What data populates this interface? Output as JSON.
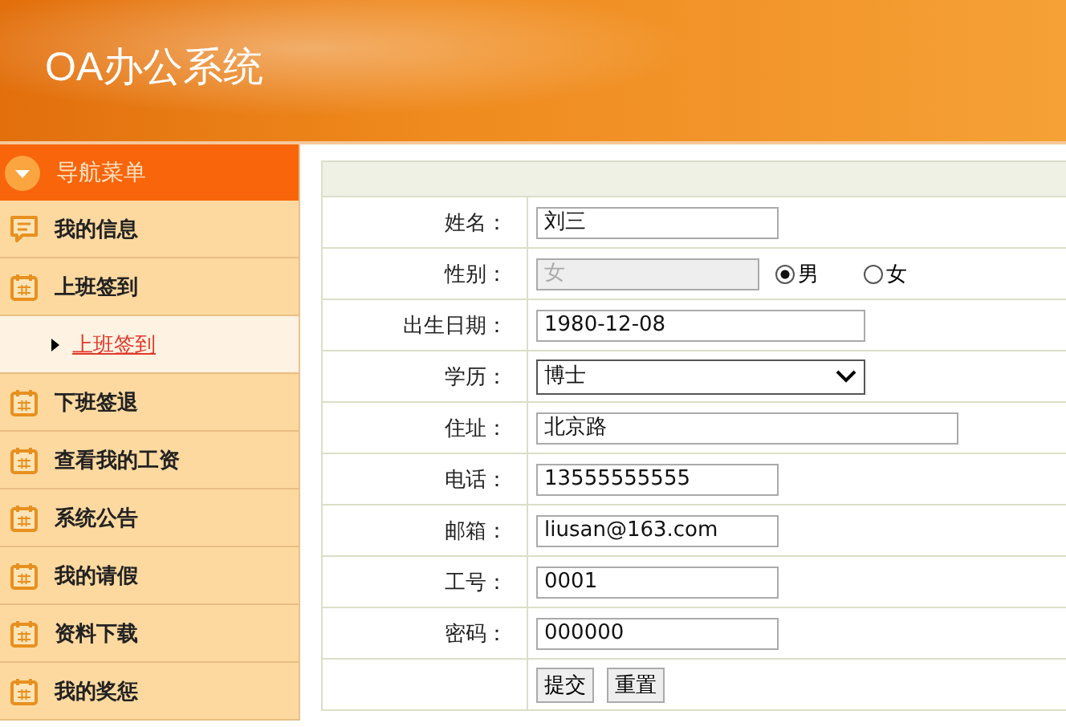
{
  "header": {
    "title": "OA办公系统"
  },
  "nav": {
    "title": "导航菜单",
    "items": [
      {
        "label": "我的信息",
        "kind": "chat"
      },
      {
        "label": "上班签到",
        "kind": "calendar",
        "children": [
          {
            "label": "上班签到",
            "selected": true
          }
        ]
      },
      {
        "label": "下班签退",
        "kind": "calendar"
      },
      {
        "label": "查看我的工资",
        "kind": "calendar"
      },
      {
        "label": "系统公告",
        "kind": "calendar"
      },
      {
        "label": "我的请假",
        "kind": "calendar"
      },
      {
        "label": "资料下载",
        "kind": "calendar"
      },
      {
        "label": "我的奖惩",
        "kind": "calendar"
      }
    ]
  },
  "form": {
    "rows": [
      {
        "label": "姓名：",
        "kind": "text",
        "value": "刘三"
      },
      {
        "label": "性别：",
        "kind": "gender",
        "placeholder": "女",
        "options": [
          {
            "label": "男",
            "selected": true
          },
          {
            "label": "女",
            "selected": false
          }
        ]
      },
      {
        "label": "出生日期：",
        "kind": "date",
        "value": "1980-12-08"
      },
      {
        "label": "学历：",
        "kind": "select",
        "value": "博士"
      },
      {
        "label": "住址：",
        "kind": "address",
        "value": "北京路"
      },
      {
        "label": "电话：",
        "kind": "text",
        "value": "13555555555"
      },
      {
        "label": "邮箱：",
        "kind": "text",
        "value": "liusan@163.com"
      },
      {
        "label": "工号：",
        "kind": "text",
        "value": "0001"
      },
      {
        "label": "密码：",
        "kind": "text",
        "value": "000000"
      },
      {
        "kind": "buttons",
        "buttons": [
          "提交",
          "重置"
        ]
      }
    ]
  }
}
